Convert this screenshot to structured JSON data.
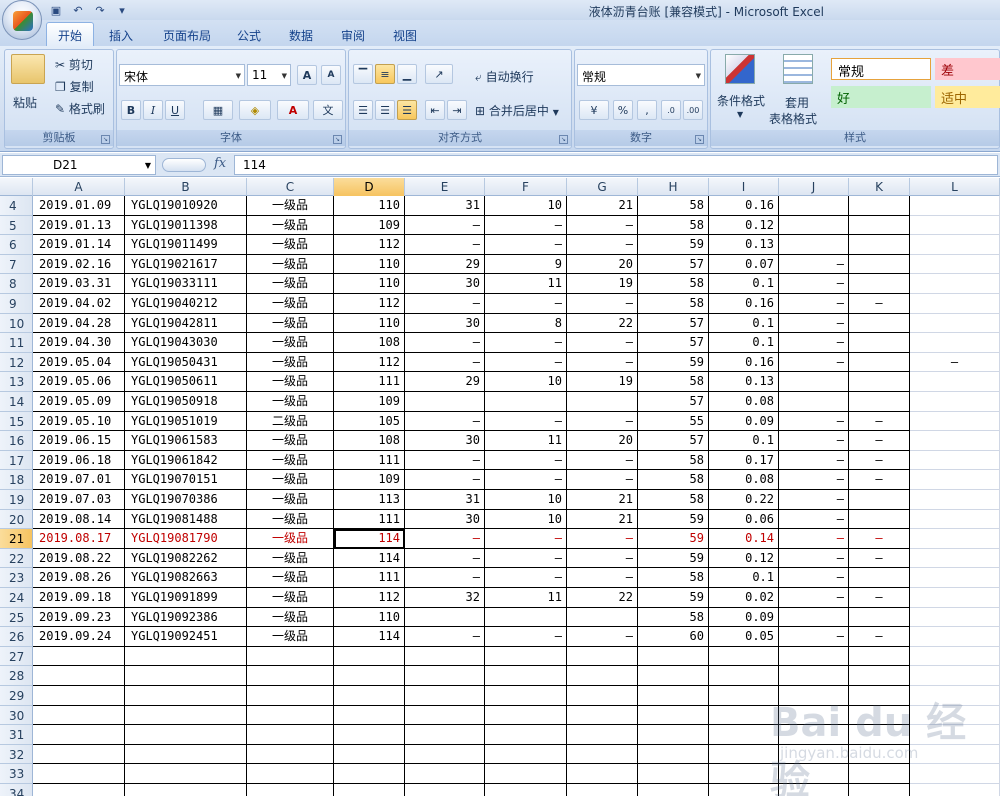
{
  "window": {
    "title": "液体沥青台账  [兼容模式] - Microsoft Excel"
  },
  "tabs": [
    "开始",
    "插入",
    "页面布局",
    "公式",
    "数据",
    "审阅",
    "视图"
  ],
  "active_tab": "开始",
  "ribbon": {
    "clipboard": {
      "paste": "粘贴",
      "cut": "剪切",
      "copy": "复制",
      "format_painter": "格式刷",
      "label": "剪贴板"
    },
    "font": {
      "name": "宋体",
      "size": "11",
      "bold": "B",
      "italic": "I",
      "underline": "U",
      "grow": "A",
      "shrink": "A",
      "label": "字体"
    },
    "alignment": {
      "wrap": "自动换行",
      "merge": "合并后居中",
      "label": "对齐方式"
    },
    "number": {
      "format": "常规",
      "percent": "%",
      "comma": ",",
      "label": "数字"
    },
    "styles": {
      "conditional": "条件格式",
      "table_line1": "套用",
      "table_line2": "表格格式",
      "normal": "常规",
      "bad": "差",
      "good": "好",
      "neutral": "适中",
      "label": "样式"
    }
  },
  "formula_bar": {
    "name_box": "D21",
    "fx": "fx",
    "value": "114"
  },
  "columns": [
    "A",
    "B",
    "C",
    "D",
    "E",
    "F",
    "G",
    "H",
    "I",
    "J",
    "K",
    "L"
  ],
  "selected_column": "D",
  "selected_row": "21",
  "rows": [
    {
      "n": "4",
      "a": "2019.01.09",
      "b": "YGLQ19010920",
      "c": "一级品",
      "d": "110",
      "e": "31",
      "f": "10",
      "g": "21",
      "h": "58",
      "i": "0.16",
      "j": "",
      "k": ""
    },
    {
      "n": "5",
      "a": "2019.01.13",
      "b": "YGLQ19011398",
      "c": "一级品",
      "d": "109",
      "e": "–",
      "f": "–",
      "g": "–",
      "h": "58",
      "i": "0.12",
      "j": "",
      "k": ""
    },
    {
      "n": "6",
      "a": "2019.01.14",
      "b": "YGLQ19011499",
      "c": "一级品",
      "d": "112",
      "e": "–",
      "f": "–",
      "g": "–",
      "h": "59",
      "i": "0.13",
      "j": "",
      "k": ""
    },
    {
      "n": "7",
      "a": "2019.02.16",
      "b": "YGLQ19021617",
      "c": "一级品",
      "d": "110",
      "e": "29",
      "f": "9",
      "g": "20",
      "h": "57",
      "i": "0.07",
      "j": "–",
      "k": ""
    },
    {
      "n": "8",
      "a": "2019.03.31",
      "b": "YGLQ19033111",
      "c": "一级品",
      "d": "110",
      "e": "30",
      "f": "11",
      "g": "19",
      "h": "58",
      "i": "0.1",
      "j": "–",
      "k": ""
    },
    {
      "n": "9",
      "a": "2019.04.02",
      "b": "YGLQ19040212",
      "c": "一级品",
      "d": "112",
      "e": "–",
      "f": "–",
      "g": "–",
      "h": "58",
      "i": "0.16",
      "j": "–",
      "k": "–"
    },
    {
      "n": "10",
      "a": "2019.04.28",
      "b": "YGLQ19042811",
      "c": "一级品",
      "d": "110",
      "e": "30",
      "f": "8",
      "g": "22",
      "h": "57",
      "i": "0.1",
      "j": "–",
      "k": ""
    },
    {
      "n": "11",
      "a": "2019.04.30",
      "b": "YGLQ19043030",
      "c": "一级品",
      "d": "108",
      "e": "–",
      "f": "–",
      "g": "–",
      "h": "57",
      "i": "0.1",
      "j": "–",
      "k": ""
    },
    {
      "n": "12",
      "a": "2019.05.04",
      "b": "YGLQ19050431",
      "c": "一级品",
      "d": "112",
      "e": "–",
      "f": "–",
      "g": "–",
      "h": "59",
      "i": "0.16",
      "j": "–",
      "k": "",
      "l": "–"
    },
    {
      "n": "13",
      "a": "2019.05.06",
      "b": "YGLQ19050611",
      "c": "一级品",
      "d": "111",
      "e": "29",
      "f": "10",
      "g": "19",
      "h": "58",
      "i": "0.13",
      "j": "",
      "k": ""
    },
    {
      "n": "14",
      "a": "2019.05.09",
      "b": "YGLQ19050918",
      "c": "一级品",
      "d": "109",
      "e": "",
      "f": "",
      "g": "",
      "h": "57",
      "i": "0.08",
      "j": "",
      "k": ""
    },
    {
      "n": "15",
      "a": "2019.05.10",
      "b": "YGLQ19051019",
      "c": "二级品",
      "d": "105",
      "e": "–",
      "f": "–",
      "g": "–",
      "h": "55",
      "i": "0.09",
      "j": "–",
      "k": "–"
    },
    {
      "n": "16",
      "a": "2019.06.15",
      "b": "YGLQ19061583",
      "c": "一级品",
      "d": "108",
      "e": "30",
      "f": "11",
      "g": "20",
      "h": "57",
      "i": "0.1",
      "j": "–",
      "k": "–"
    },
    {
      "n": "17",
      "a": "2019.06.18",
      "b": "YGLQ19061842",
      "c": "一级品",
      "d": "111",
      "e": "–",
      "f": "–",
      "g": "–",
      "h": "58",
      "i": "0.17",
      "j": "–",
      "k": "–"
    },
    {
      "n": "18",
      "a": "2019.07.01",
      "b": "YGLQ19070151",
      "c": "一级品",
      "d": "109",
      "e": "–",
      "f": "–",
      "g": "–",
      "h": "58",
      "i": "0.08",
      "j": "–",
      "k": "–"
    },
    {
      "n": "19",
      "a": "2019.07.03",
      "b": "YGLQ19070386",
      "c": "一级品",
      "d": "113",
      "e": "31",
      "f": "10",
      "g": "21",
      "h": "58",
      "i": "0.22",
      "j": "–",
      "k": ""
    },
    {
      "n": "20",
      "a": "2019.08.14",
      "b": "YGLQ19081488",
      "c": "一级品",
      "d": "111",
      "e": "30",
      "f": "10",
      "g": "21",
      "h": "59",
      "i": "0.06",
      "j": "–",
      "k": ""
    },
    {
      "n": "21",
      "a": "2019.08.17",
      "b": "YGLQ19081790",
      "c": "一级品",
      "d": "114",
      "e": "–",
      "f": "–",
      "g": "–",
      "h": "59",
      "i": "0.14",
      "j": "–",
      "k": "–",
      "red": true
    },
    {
      "n": "22",
      "a": "2019.08.22",
      "b": "YGLQ19082262",
      "c": "一级品",
      "d": "114",
      "e": "–",
      "f": "–",
      "g": "–",
      "h": "59",
      "i": "0.12",
      "j": "–",
      "k": "–"
    },
    {
      "n": "23",
      "a": "2019.08.26",
      "b": "YGLQ19082663",
      "c": "一级品",
      "d": "111",
      "e": "–",
      "f": "–",
      "g": "–",
      "h": "58",
      "i": "0.1",
      "j": "–",
      "k": ""
    },
    {
      "n": "24",
      "a": "2019.09.18",
      "b": "YGLQ19091899",
      "c": "一级品",
      "d": "112",
      "e": "32",
      "f": "11",
      "g": "22",
      "h": "59",
      "i": "0.02",
      "j": "–",
      "k": "–"
    },
    {
      "n": "25",
      "a": "2019.09.23",
      "b": "YGLQ19092386",
      "c": "一级品",
      "d": "110",
      "e": "",
      "f": "",
      "g": "",
      "h": "58",
      "i": "0.09",
      "j": "",
      "k": ""
    },
    {
      "n": "26",
      "a": "2019.09.24",
      "b": "YGLQ19092451",
      "c": "一级品",
      "d": "114",
      "e": "–",
      "f": "–",
      "g": "–",
      "h": "60",
      "i": "0.05",
      "j": "–",
      "k": "–"
    }
  ],
  "empty_rows": [
    "27",
    "28",
    "29",
    "30",
    "31",
    "32",
    "33",
    "34"
  ],
  "colors": {
    "selection": "#f6c360",
    "red_text": "#c00000",
    "ribbon": "#d1def0"
  },
  "watermark": {
    "brand": "Bai du 经验",
    "url": "jingyan.baidu.com"
  }
}
